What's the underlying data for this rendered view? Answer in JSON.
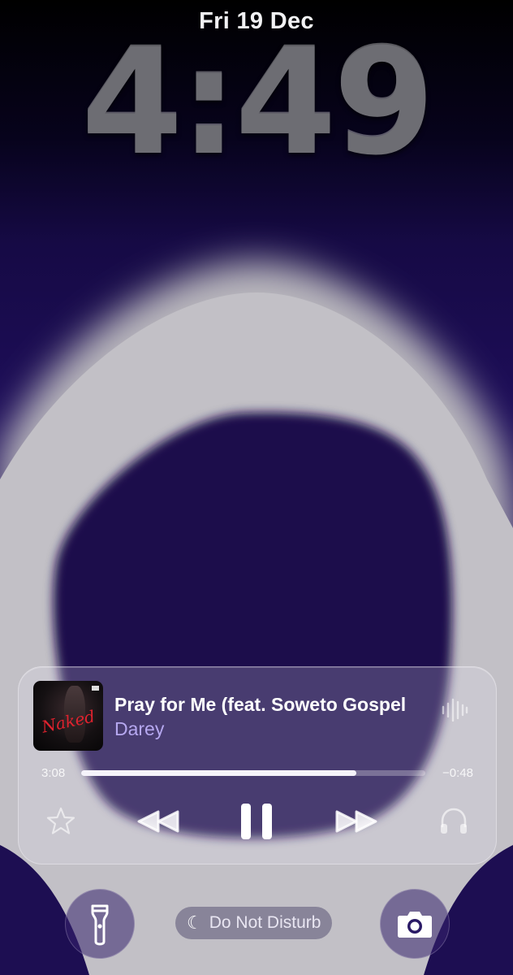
{
  "lock_screen": {
    "date": "Fri 19 Dec",
    "time": "4:49"
  },
  "now_playing": {
    "title": "Pray for Me (feat. Soweto Gospel",
    "artist": "Darey",
    "artwork_text": "Naked",
    "elapsed": "3:08",
    "remaining": "−0:48",
    "progress": 0.8,
    "controls": [
      "star-icon",
      "rewind-icon",
      "pause-icon",
      "fast-forward-icon",
      "headphones-icon"
    ]
  },
  "quick_actions": {
    "focus_label": "Do Not Disturb",
    "left_icon": "flashlight-icon",
    "right_icon": "camera-icon"
  },
  "colors": {
    "accent": "#b6a8f0",
    "wallpaper_purple": "#1e0e5a"
  }
}
